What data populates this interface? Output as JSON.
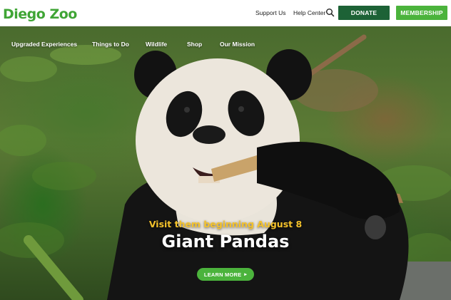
{
  "header": {
    "logo_text": "Diego Zoo",
    "support_label": "Support Us",
    "help_label": "Help Center",
    "search_icon": "search-icon",
    "donate_label": "DONATE",
    "membership_label": "MEMBERSHIP",
    "brand_green": "#3fa535",
    "donate_color": "#1d6236",
    "membership_color": "#4bb33c"
  },
  "nav": {
    "items": [
      {
        "label": "Upgraded Experiences"
      },
      {
        "label": "Things to Do"
      },
      {
        "label": "Wildlife"
      },
      {
        "label": "Shop"
      },
      {
        "label": "Our Mission"
      }
    ]
  },
  "hero": {
    "subtitle": "Visit them beginning August 8",
    "headline": "Giant Pandas",
    "cta_label": "LEARN MORE",
    "cta_arrow": "▸",
    "subtitle_color": "#f4c22b"
  }
}
